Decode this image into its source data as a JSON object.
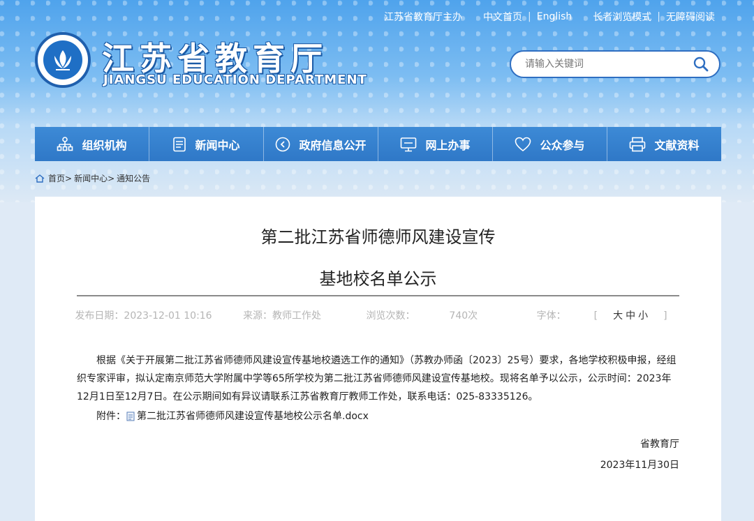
{
  "topbar": {
    "sponsor": "江苏省教育厅主办",
    "home_cn": "中文首页",
    "english": "English",
    "elder_mode": "长者浏览模式",
    "accessible": "无障碍阅读",
    "sep": "|"
  },
  "brand": {
    "name_cn": "江苏省教育厅",
    "name_en": "JIANGSU EDUCATION DEPARTMENT"
  },
  "search": {
    "placeholder": "请输入关键词"
  },
  "nav": {
    "items": [
      {
        "label": "组织机构",
        "icon": "org-chart-icon"
      },
      {
        "label": "新闻中心",
        "icon": "news-icon"
      },
      {
        "label": "政府信息公开",
        "icon": "info-disclosure-icon"
      },
      {
        "label": "网上办事",
        "icon": "monitor-icon"
      },
      {
        "label": "公众参与",
        "icon": "heart-icon"
      },
      {
        "label": "文献资料",
        "icon": "printer-icon"
      }
    ]
  },
  "breadcrumb": {
    "home": "首页",
    "news": "新闻中心",
    "notice": "通知公告",
    "sep": ">"
  },
  "article": {
    "title_line1": "第二批江苏省师德师风建设宣传",
    "title_line2": "基地校名单公示",
    "publish_date": "发布日期：2023-12-01 10:16",
    "source": "来源：教师工作处",
    "views_label": "浏览次数：",
    "views": "740次",
    "font_label": "字体：",
    "font_open": "[",
    "font_large": "大",
    "font_medium": "中",
    "font_small": "小",
    "font_close": "]",
    "paragraph": "根据《关于开展第二批江苏省师德师风建设宣传基地校遴选工作的通知》（苏教办师函〔2023〕25号）要求，各地学校积极申报，经组织专家评审，拟认定南京师范大学附属中学等65所学校为第二批江苏省师德师风建设宣传基地校。现将名单予以公示，公示时间：2023年12月1日至12月7日。在公示期间如有异议请联系江苏省教育厅教师工作处，联系电话：025-83335126。",
    "attachment_label": "附件：",
    "attachment_file": "第二批江苏省师德师风建设宣传基地校公示名单.docx",
    "signature": "省教育厅",
    "sign_date": "2023年11月30日"
  },
  "colors": {
    "nav_blue": "#3d8ad6",
    "brand_blue": "#1f5fad",
    "meta_gray": "#b5b5b5"
  }
}
